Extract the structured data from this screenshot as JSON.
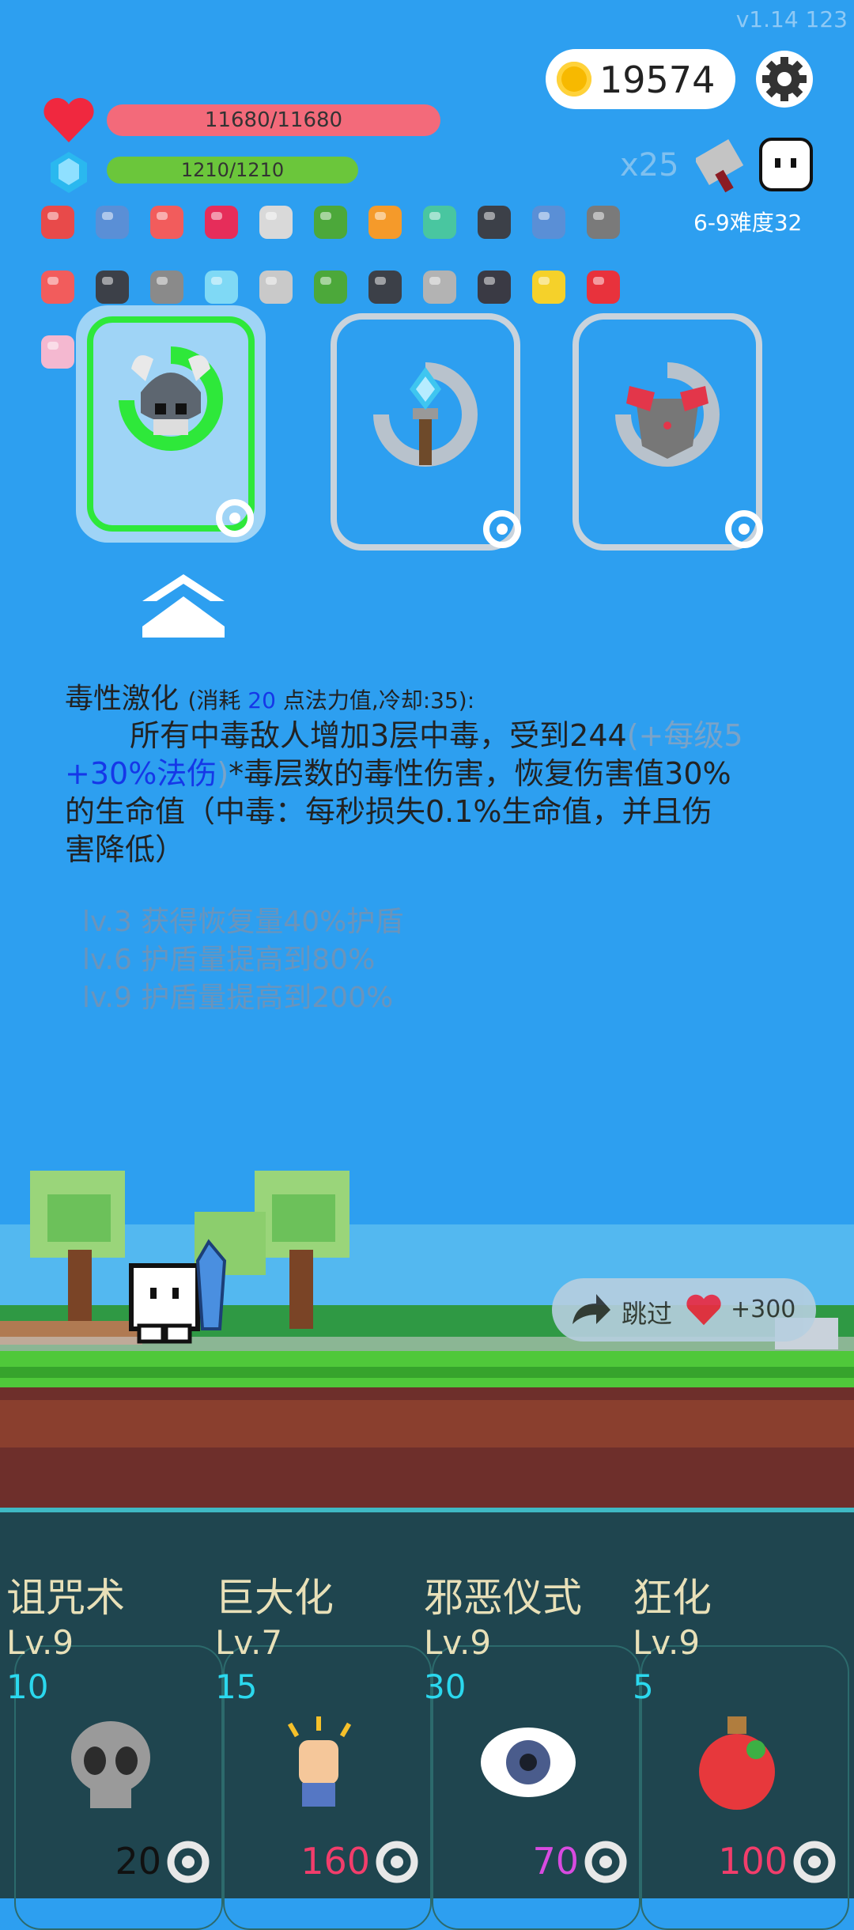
{
  "status": {
    "version": "v1.14 123"
  },
  "top": {
    "coins": "19574"
  },
  "bars": {
    "hp": "11680/11680",
    "mp": "1210/1210"
  },
  "stage": {
    "multiplier": "x25",
    "difficulty": "6-9难度32"
  },
  "colors": {
    "background": "#2d9ff0",
    "hp": "#f36a7a",
    "mp": "#6bc63b",
    "selected": "#2ee83a",
    "panel": "#1f454f",
    "accent_cost": "#2bd8ee"
  },
  "inventory": {
    "row1": [
      "shoe-icon",
      "shield-icon",
      "pill-icon",
      "ruby-icon",
      "sword-icon",
      "plant-icon",
      "torch-icon",
      "potion-icon",
      "tome-icon",
      "shield-icon",
      "mortar-icon"
    ],
    "row2": [
      "pill-icon",
      "tome-icon",
      "helmet-icon",
      "diamond-icon",
      "ring-icon",
      "tree-icon",
      "tome-icon",
      "dagger-icon",
      "bat-icon",
      "lemon-icon",
      "mushroom-icon"
    ],
    "row3": [
      "icecream-icon",
      "cauldron-icon",
      "potion-icon"
    ]
  },
  "choices": [
    {
      "icon": "viking-skull-icon",
      "selected": true
    },
    {
      "icon": "ice-torch-icon",
      "selected": false
    },
    {
      "icon": "armor-icon",
      "selected": false
    }
  ],
  "description": {
    "title": "毒性激化",
    "meta_prefix": "(消耗 ",
    "meta_cost": "20",
    "meta_suffix": " 点法力值,冷却:35):",
    "line_a": "所有中毒敌人增加3层中毒，受到244",
    "line_a_grey": "(+每级5",
    "line_b_blue": "+30%法伤",
    "line_b_grey": ")",
    "line_b_rest": "*毒层数的毒性伤害，恢复伤害值30%",
    "line_c": "的生命值（中毒：每秒损失0.1%生命值，并且伤",
    "line_d": "害降低）",
    "levels": [
      "lv.3 获得恢复量40%护盾",
      "lv.6 护盾量提高到80%",
      "lv.9 护盾量提高到200%"
    ]
  },
  "skip": {
    "label": "跳过",
    "bonus": "+300"
  },
  "skills": [
    {
      "name": "诅咒术",
      "level": "Lv.9",
      "cost": "10",
      "price": "20",
      "price_color": "#111111",
      "icon": "skull-icon"
    },
    {
      "name": "巨大化",
      "level": "Lv.7",
      "cost": "15",
      "price": "160",
      "price_color": "#f23d6b",
      "icon": "fist-icon"
    },
    {
      "name": "邪恶仪式",
      "level": "Lv.9",
      "cost": "30",
      "price": "70",
      "price_color": "#d84be0",
      "icon": "eye-icon"
    },
    {
      "name": "狂化",
      "level": "Lv.9",
      "cost": "5",
      "price": "100",
      "price_color": "#f23d6b",
      "icon": "red-potion-icon"
    }
  ]
}
